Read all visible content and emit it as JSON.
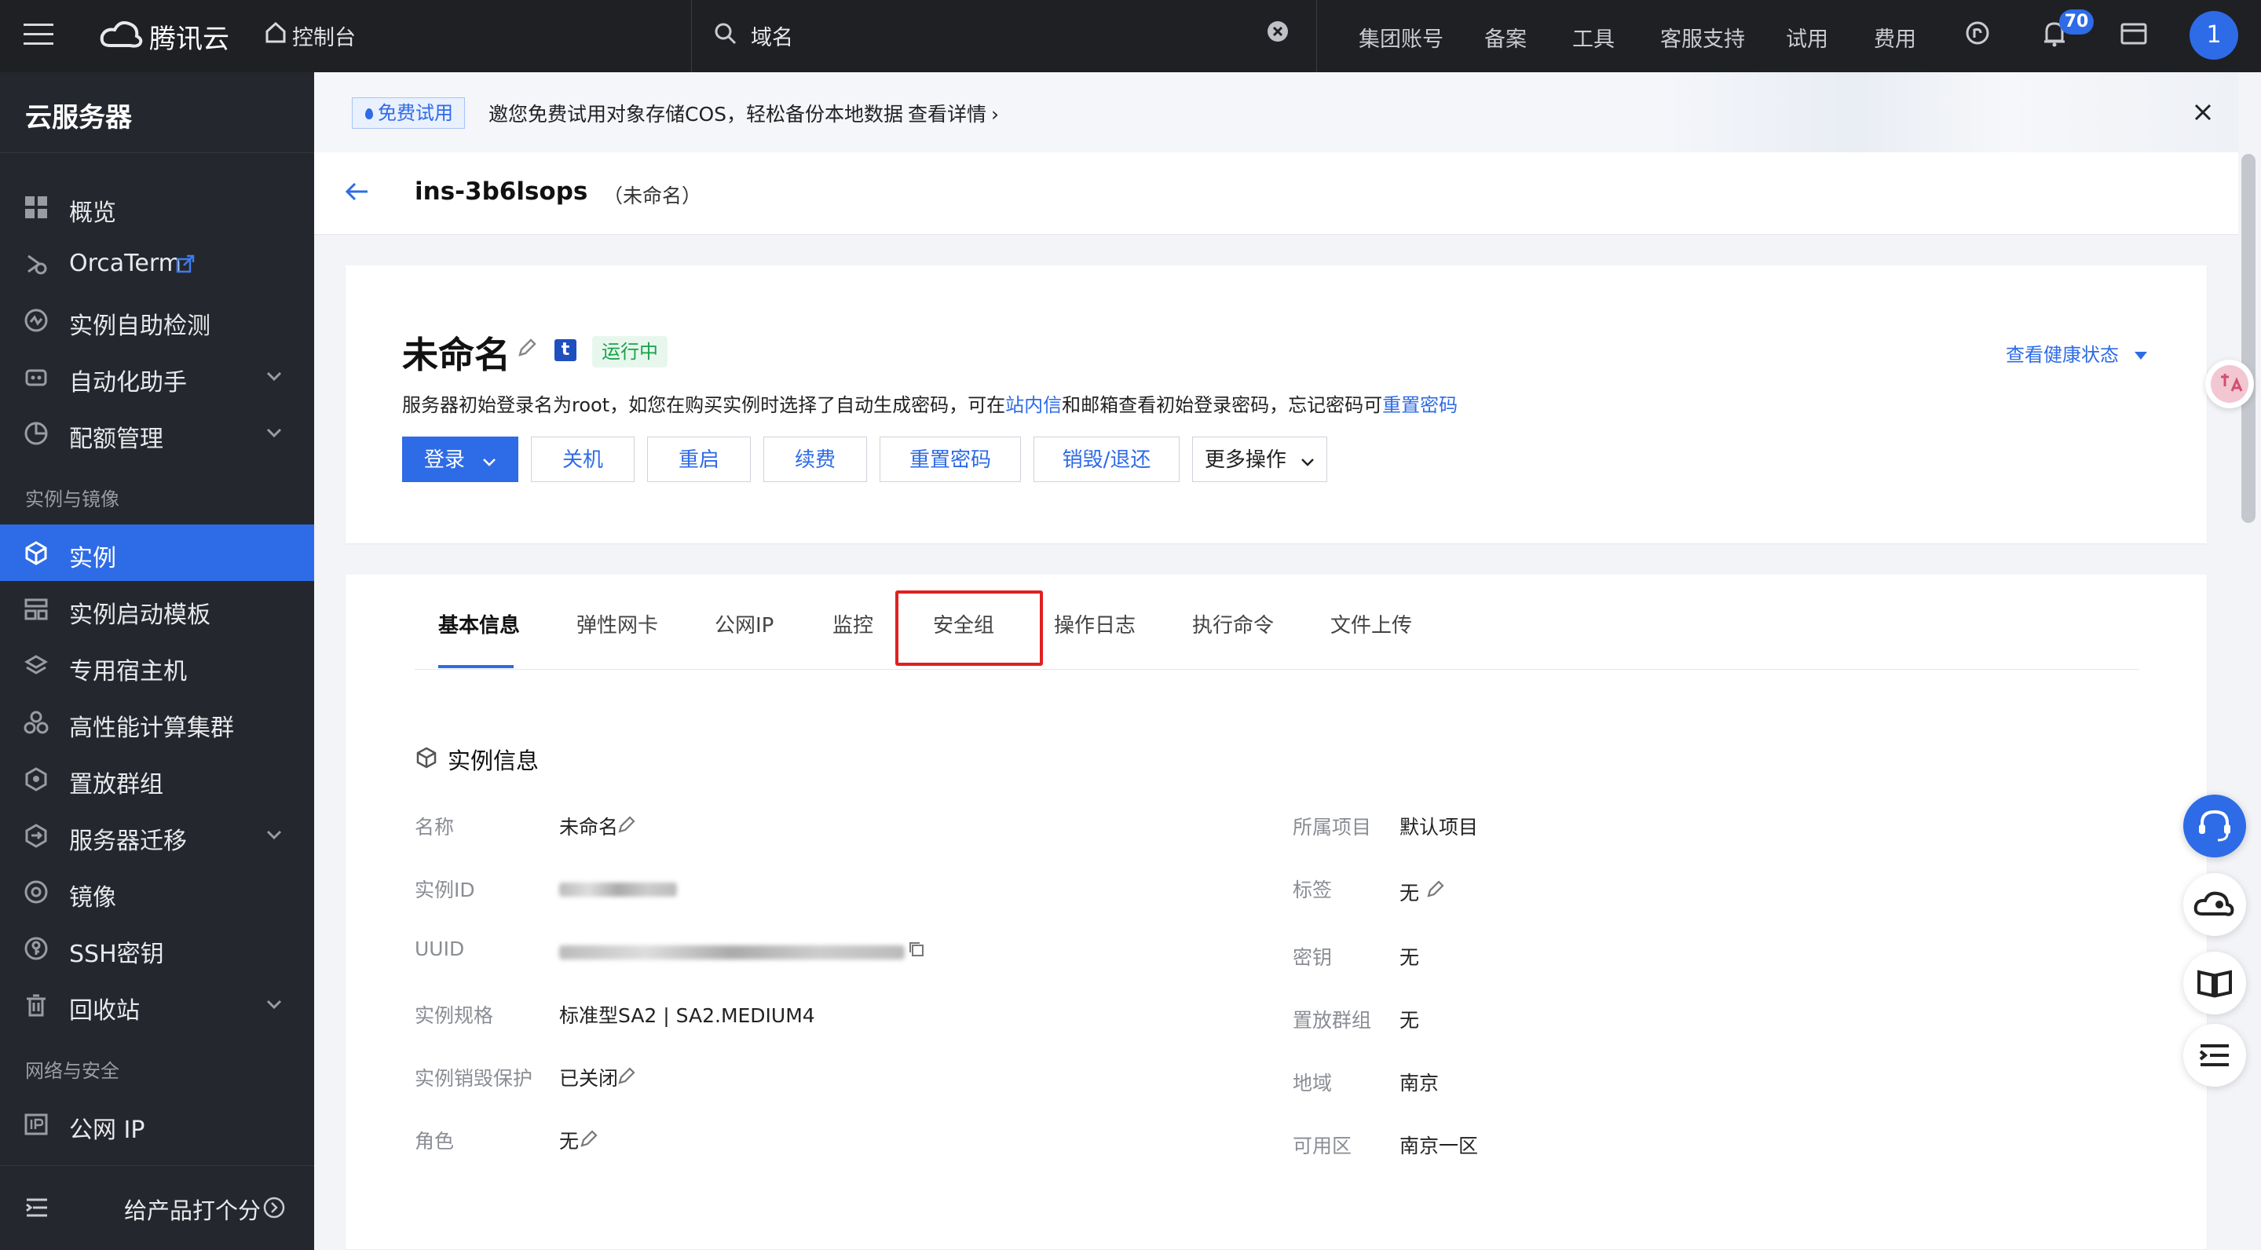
{
  "topbar": {
    "brand": "腾讯云",
    "console": "控制台",
    "search_value": "域名",
    "nav": [
      "集团账号",
      "备案",
      "工具",
      "客服支持",
      "试用",
      "费用"
    ],
    "notification_count": "70",
    "avatar": "1"
  },
  "sidebar": {
    "title": "云服务器",
    "items": [
      {
        "label": "概览"
      },
      {
        "label": "OrcaTerm"
      },
      {
        "label": "实例自助检测"
      },
      {
        "label": "自动化助手"
      },
      {
        "label": "配额管理"
      },
      {
        "label": "实例"
      },
      {
        "label": "实例启动模板"
      },
      {
        "label": "专用宿主机"
      },
      {
        "label": "高性能计算集群"
      },
      {
        "label": "置放群组"
      },
      {
        "label": "服务器迁移"
      },
      {
        "label": "镜像"
      },
      {
        "label": "SSH密钥"
      },
      {
        "label": "回收站"
      },
      {
        "label": "公网 IP"
      }
    ],
    "section_1": "实例与镜像",
    "section_2": "网络与安全",
    "feedback": "给产品打个分"
  },
  "banner": {
    "tag": "免费试用",
    "text": "邀您免费试用对象存储COS，轻松备份本地数据",
    "link": "查看详情"
  },
  "header": {
    "instance_id": "ins-3b6lsops",
    "instance_name": "（未命名）"
  },
  "summary": {
    "title": "未命名",
    "status": "运行中",
    "health": "查看健康状态",
    "desc_1": "服务器初始登录名为root，如您在购买实例时选择了自动生成密码，可在",
    "desc_link_1": "站内信",
    "desc_2": "和邮箱查看初始登录密码，忘记密码可",
    "desc_link_2": "重置密码",
    "buttons": {
      "login": "登录",
      "shutdown": "关机",
      "restart": "重启",
      "renew": "续费",
      "reset_password": "重置密码",
      "destroy": "销毁/退还",
      "more": "更多操作"
    }
  },
  "tabs": [
    "基本信息",
    "弹性网卡",
    "公网IP",
    "监控",
    "安全组",
    "操作日志",
    "执行命令",
    "文件上传"
  ],
  "instance_info": {
    "title": "实例信息",
    "left": [
      {
        "label": "名称",
        "value": "未命名"
      },
      {
        "label": "实例ID",
        "value": ""
      },
      {
        "label": "UUID",
        "value": ""
      },
      {
        "label": "实例规格",
        "value": "标准型SA2 | SA2.MEDIUM4"
      },
      {
        "label": "实例销毁保护",
        "value": "已关闭"
      },
      {
        "label": "角色",
        "value": "无"
      }
    ],
    "right": [
      {
        "label": "所属项目",
        "value": "默认项目"
      },
      {
        "label": "标签",
        "value": "无"
      },
      {
        "label": "密钥",
        "value": "无"
      },
      {
        "label": "置放群组",
        "value": "无"
      },
      {
        "label": "地域",
        "value": "南京"
      },
      {
        "label": "可用区",
        "value": "南京一区"
      }
    ]
  }
}
